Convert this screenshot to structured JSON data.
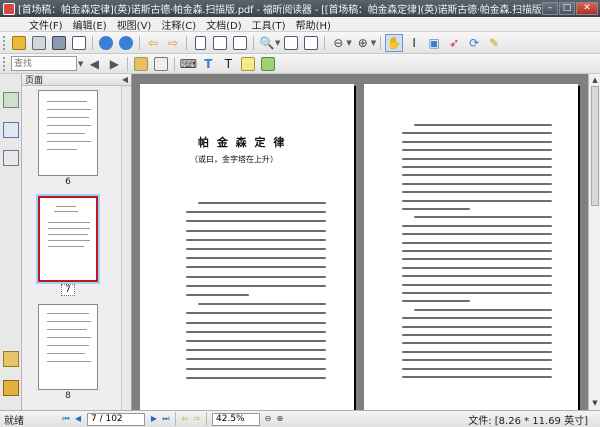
{
  "window": {
    "title": "[首场稿：帕金森定律](英)诺斯古德·帕金森.扫描版.pdf - 福昕阅读器 - [[首场稿：帕金森定律](英)诺斯古德·帕金森.扫描版.pdf]"
  },
  "menu": {
    "items": [
      "文件(F)",
      "编辑(E)",
      "视图(V)",
      "注释(C)",
      "文档(D)",
      "工具(T)",
      "帮助(H)"
    ]
  },
  "search": {
    "placeholder": "查找",
    "value": ""
  },
  "sidebar": {
    "panel_title": "页面",
    "thumbnails": [
      {
        "label": "6",
        "selected": false
      },
      {
        "label": "7",
        "selected": true
      },
      {
        "label": "8",
        "selected": false
      }
    ]
  },
  "document": {
    "left_page": {
      "title": "帕 金 森 定 律",
      "subtitle": "（或曰，金字塔在上升）"
    }
  },
  "status": {
    "ready": "就绪",
    "page_value": "7 / 102",
    "zoom_value": "42.5%",
    "file_info": "文件: [8.26 * 11.69 英寸]"
  },
  "colors": {
    "accent": "#1c6fbf",
    "selection_border": "#c01818",
    "doc_background": "#7f7f7f"
  }
}
